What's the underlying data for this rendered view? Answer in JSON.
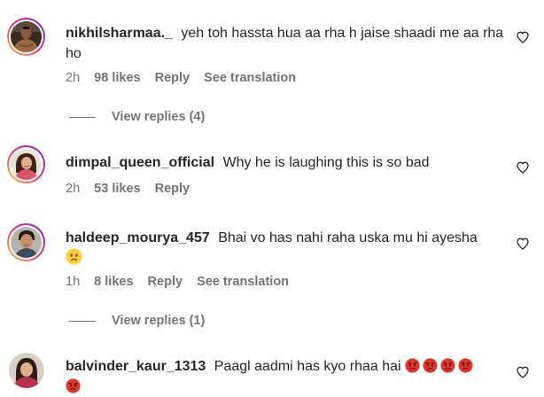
{
  "comments": [
    {
      "username": "nikhilsharmaa._",
      "text": "yeh toh hassta hua aa rha h jaise shaadi me aa rha ho",
      "time": "2h",
      "likes": "98 likes",
      "reply": "Reply",
      "see_translation": "See translation",
      "view_replies": "View replies (4)",
      "avatar_icon": "avatar-man-shirtless"
    },
    {
      "username": "dimpal_queen_official",
      "text": "Why he is laughing this is so bad",
      "time": "2h",
      "likes": "53 likes",
      "reply": "Reply",
      "avatar_icon": "avatar-woman"
    },
    {
      "username": "haldeep_mourya_457",
      "text": "Bhai vo has nahi raha uska mu hi ayesha",
      "emoji": "worried-face-emoji",
      "time": "1h",
      "likes": "8 likes",
      "reply": "Reply",
      "see_translation": "See translation",
      "view_replies": "View replies (1)",
      "avatar_icon": "avatar-young-man"
    },
    {
      "username": "balvinder_kaur_1313",
      "text": "Paagl aadmi has kyo rhaa hai",
      "emoji": "angry-face-emoji",
      "emoji_count": 5,
      "avatar_icon": "avatar-woman-portrait"
    }
  ],
  "colors": {
    "text": "#262626",
    "secondary": "#737373",
    "story_ring_start": "#f9ce34",
    "story_ring_mid": "#ee2a7b",
    "story_ring_end": "#6228d7",
    "angry_emoji": "#e0352b"
  },
  "icons": {
    "like": "heart-outline-icon"
  }
}
